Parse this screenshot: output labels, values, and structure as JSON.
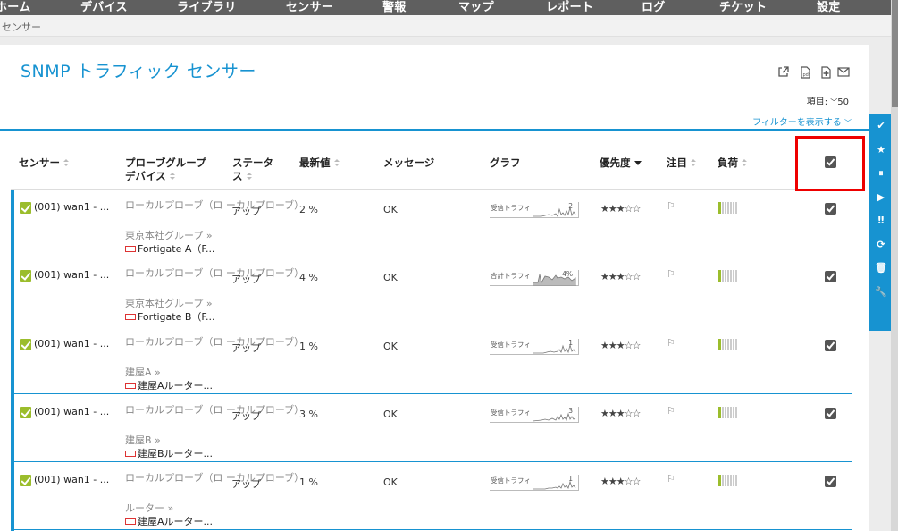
{
  "nav": [
    "ホーム",
    "デバイス",
    "ライブラリ",
    "センサー",
    "警報",
    "マップ",
    "レポート",
    "ログ",
    "チケット",
    "設定"
  ],
  "breadcrumb": "センサー",
  "page_title": "SNMP トラフィック センサー",
  "toolbar_icons": [
    "external-link-icon",
    "pdf-icon",
    "add-document-icon",
    "mail-icon"
  ],
  "items_label": "項目:",
  "items_count": "50",
  "filter_link": "フィルターを表示する",
  "columns": {
    "sensor": "センサー",
    "probe_group_line1": "プローブグループ",
    "probe_group_line2": "デバイス",
    "status_line1": "ステータ",
    "status_line2": "ス",
    "last_value": "最新値",
    "message": "メッセージ",
    "graph": "グラフ",
    "priority": "優先度",
    "favorite": "注目",
    "load": "負荷"
  },
  "rows": [
    {
      "sensor": "(001) wan1 - ...",
      "probe": "ローカルプローブ（ロ ーカルプローブ）",
      "group": "東京本社グループ",
      "device": "Fortigate A（F...",
      "status": "アップ",
      "last_value": "2 %",
      "message": "OK",
      "graph_label": "受信トラフィ",
      "graph_val": "2",
      "priority": 3
    },
    {
      "sensor": "(001) wan1 - ...",
      "probe": "ローカルプローブ（ロ ーカルプローブ）",
      "group": "東京本社グループ",
      "device": "Fortigate B（F...",
      "status": "アップ",
      "last_value": "4 %",
      "message": "OK",
      "graph_label": "合計トラフィ",
      "graph_val": "4%",
      "priority": 3
    },
    {
      "sensor": "(001) wan1 - ...",
      "probe": "ローカルプローブ（ロ ーカルプローブ）",
      "group": "建屋A",
      "device": "建屋Aルーター...",
      "status": "アップ",
      "last_value": "1 %",
      "message": "OK",
      "graph_label": "受信トラフィ",
      "graph_val": "1",
      "priority": 3
    },
    {
      "sensor": "(001) wan1 - ...",
      "probe": "ローカルプローブ（ロ ーカルプローブ）",
      "group": "建屋B",
      "device": "建屋Bルーター...",
      "status": "アップ",
      "last_value": "3 %",
      "message": "OK",
      "graph_label": "受信トラフィ",
      "graph_val": "3",
      "priority": 3
    },
    {
      "sensor": "(001) wan1 - ...",
      "probe": "ローカルプローブ（ロ ーカルプローブ）",
      "group": "ルーター",
      "device": "建屋Aルーター...",
      "status": "アップ",
      "last_value": "1 %",
      "message": "OK",
      "graph_label": "受信トラフィ",
      "graph_val": "1",
      "priority": 3
    }
  ],
  "side_toolbar": [
    "check-icon",
    "star-icon",
    "pause-icon",
    "play-icon",
    "priority-icon",
    "refresh-icon",
    "delete-icon",
    "wrench-icon"
  ],
  "side_toolbar_glyphs": [
    "✔",
    "★",
    "⏸",
    "▶",
    "‼",
    "⟳",
    "🗑",
    "🔧"
  ],
  "accent_color": "#1793d1",
  "ok_color": "#9bbd2c",
  "highlight_color": "#ee0000"
}
